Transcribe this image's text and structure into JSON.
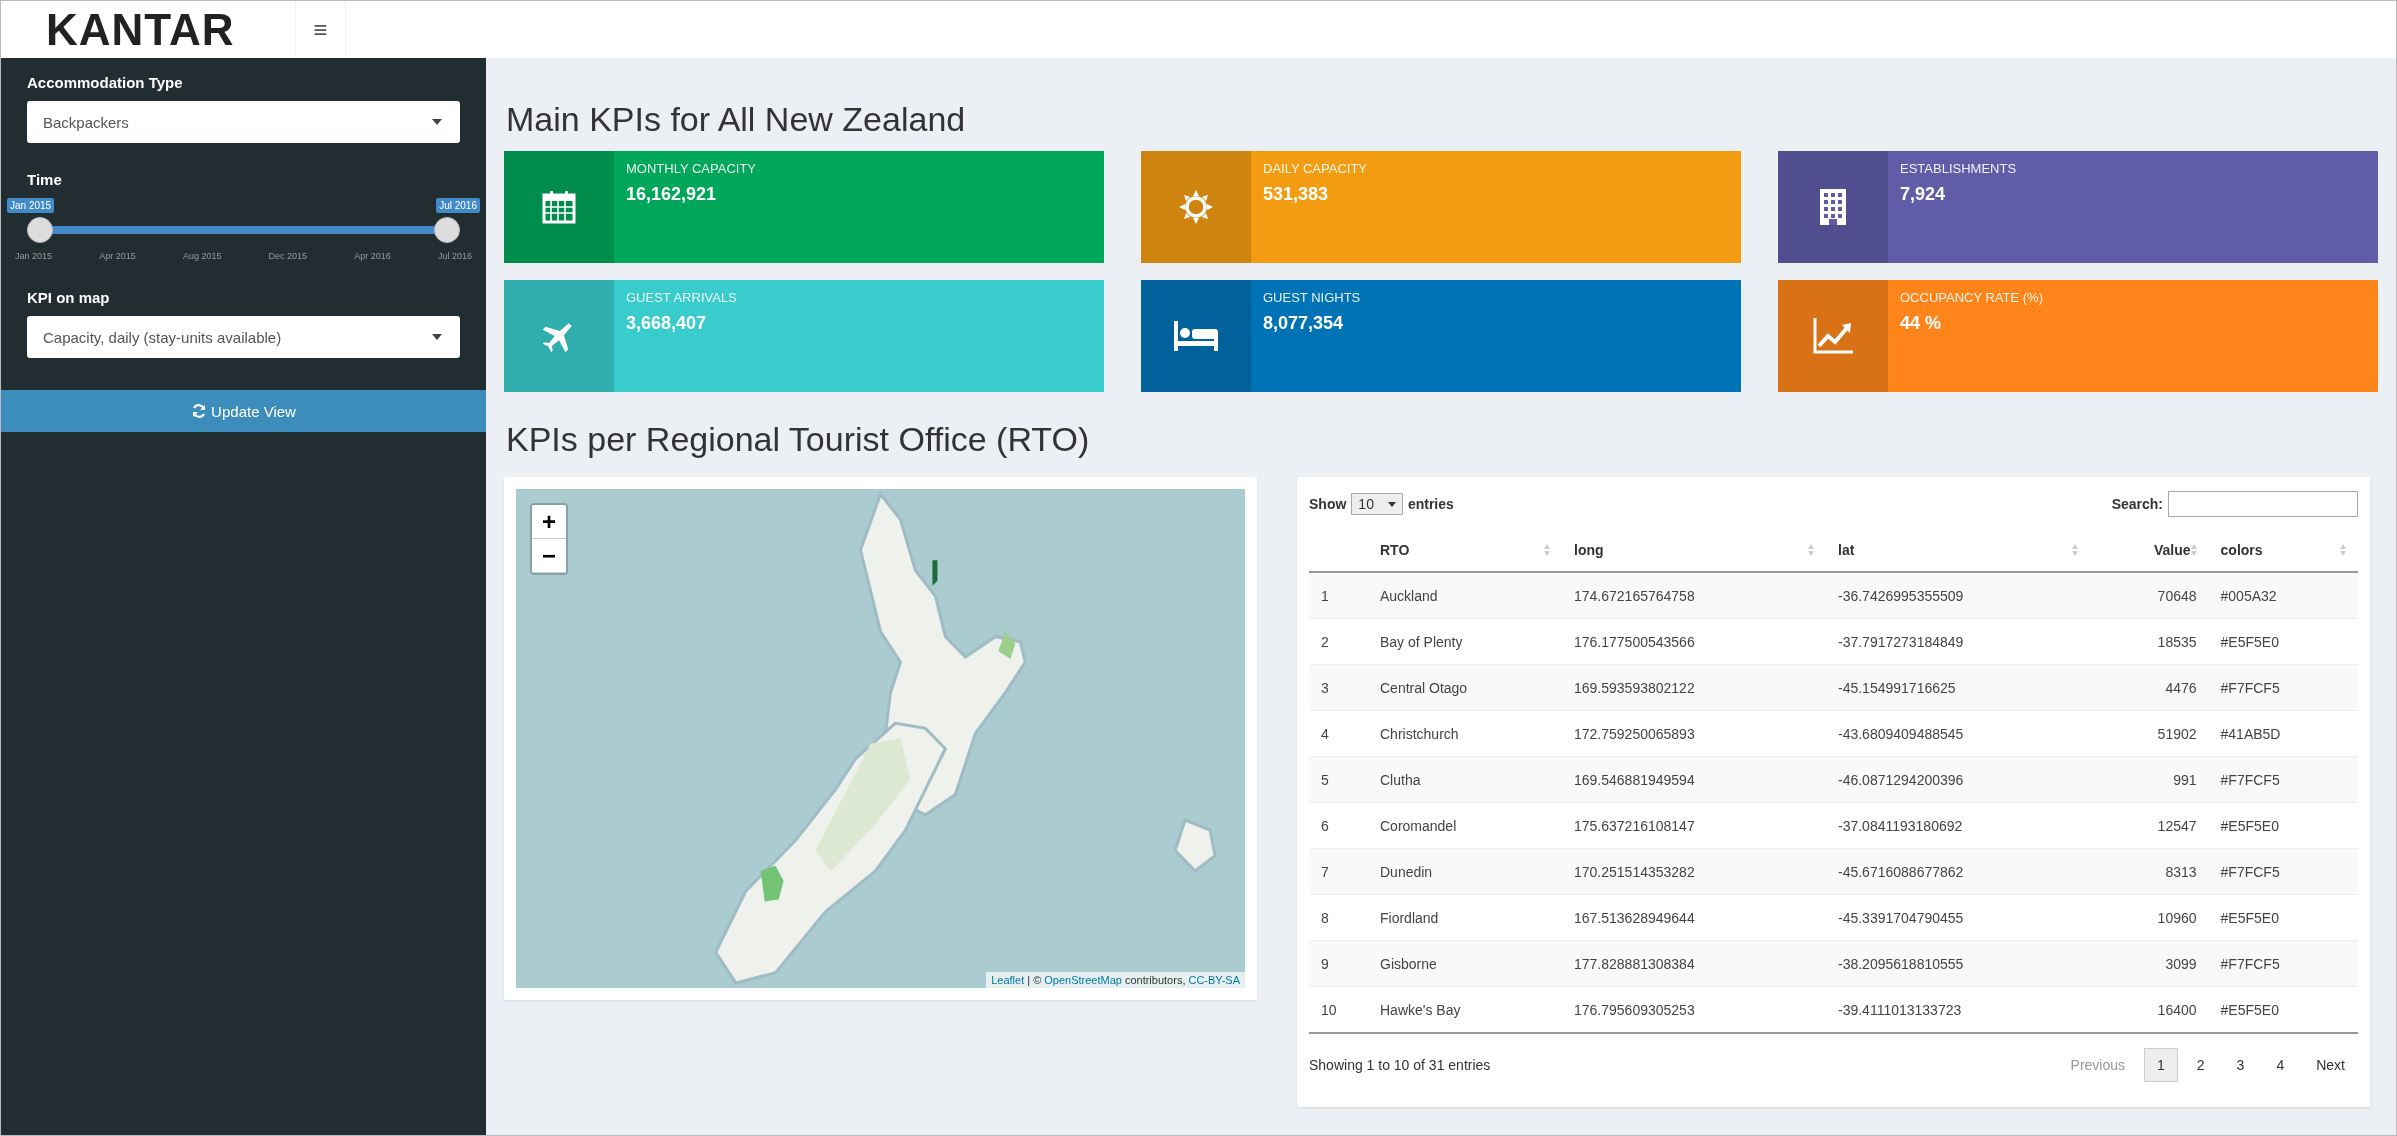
{
  "header": {
    "logo": "KANTAR",
    "menu_toggle": "≡"
  },
  "sidebar": {
    "accommodation": {
      "label": "Accommodation Type",
      "value": "Backpackers"
    },
    "time": {
      "label": "Time",
      "from": "Jan 2015",
      "to": "Jul 2016",
      "level": 1,
      "ticks": [
        "Jan 2015",
        "Apr 2015",
        "Aug 2015",
        "Dec 2015",
        "Apr 2016",
        "Jul 2016"
      ]
    },
    "kpi": {
      "label": "KPI on map",
      "value": "Capacity, daily (stay-units available)"
    },
    "button": "Update View"
  },
  "kpi_title": "Main KPIs for All New Zealand",
  "kpis": [
    {
      "kind": "calendar",
      "label": "MONTHLY CAPACITY",
      "value": "16,162,921",
      "color": "#00a65a"
    },
    {
      "kind": "sun",
      "label": "DAILY CAPACITY",
      "value": "531,383",
      "color": "#f39c12"
    },
    {
      "kind": "building",
      "label": "ESTABLISHMENTS",
      "value": "7,924",
      "color": "#605ca8"
    },
    {
      "kind": "plane",
      "label": "GUEST ARRIVALS",
      "value": "3,668,407",
      "color": "#39cccc"
    },
    {
      "kind": "bed",
      "label": "GUEST NIGHTS",
      "value": "8,077,354",
      "color": "#0073b7"
    },
    {
      "kind": "chart",
      "label": "OCCUPANCY RATE (%)",
      "value": "44 %",
      "color": "#ff851b"
    }
  ],
  "rto_title": "KPIs per Regional Tourist Office (RTO)",
  "map": {
    "zoom_in": "+",
    "zoom_out": "−",
    "attribution_link": "Leaflet",
    "attribution_sep": "| ©",
    "attribution_osm": "OpenStreetMap",
    "attribution_text": "contributors,",
    "attribution_license": "CC-BY-SA"
  },
  "table": {
    "show": "Show",
    "length": "10",
    "entries": "entries",
    "search_label": "Search:",
    "columns": [
      "",
      "RTO",
      "long",
      "lat",
      "Value",
      "colors"
    ],
    "rows": [
      [
        "1",
        "Auckland",
        "174.672165764758",
        "-36.7426995355509",
        "70648",
        "#005A32"
      ],
      [
        "2",
        "Bay of Plenty",
        "176.177500543566",
        "-37.7917273184849",
        "18535",
        "#E5F5E0"
      ],
      [
        "3",
        "Central Otago",
        "169.593593802122",
        "-45.154991716625",
        "4476",
        "#F7FCF5"
      ],
      [
        "4",
        "Christchurch",
        "172.759250065893",
        "-43.6809409488545",
        "51902",
        "#41AB5D"
      ],
      [
        "5",
        "Clutha",
        "169.546881949594",
        "-46.0871294200396",
        "991",
        "#F7FCF5"
      ],
      [
        "6",
        "Coromandel",
        "175.637216108147",
        "-37.0841193180692",
        "12547",
        "#E5F5E0"
      ],
      [
        "7",
        "Dunedin",
        "170.251514353282",
        "-45.6716088677862",
        "8313",
        "#F7FCF5"
      ],
      [
        "8",
        "Fiordland",
        "167.513628949644",
        "-45.3391704790455",
        "10960",
        "#E5F5E0"
      ],
      [
        "9",
        "Gisborne",
        "177.828881308384",
        "-38.2095618810555",
        "3099",
        "#F7FCF5"
      ],
      [
        "10",
        "Hawke's Bay",
        "176.795609305253",
        "-39.4111013133723",
        "16400",
        "#E5F5E0"
      ]
    ],
    "info": "Showing 1 to 10 of 31 entries",
    "pagination": [
      {
        "label": "Previous",
        "selected": false,
        "disabled": true
      },
      {
        "label": "1",
        "selected": true,
        "disabled": false
      },
      {
        "label": "2",
        "selected": false,
        "disabled": false
      },
      {
        "label": "3",
        "selected": false,
        "disabled": false
      },
      {
        "label": "4",
        "selected": false,
        "disabled": false
      },
      {
        "label": "Next",
        "selected": false,
        "disabled": false
      }
    ]
  }
}
